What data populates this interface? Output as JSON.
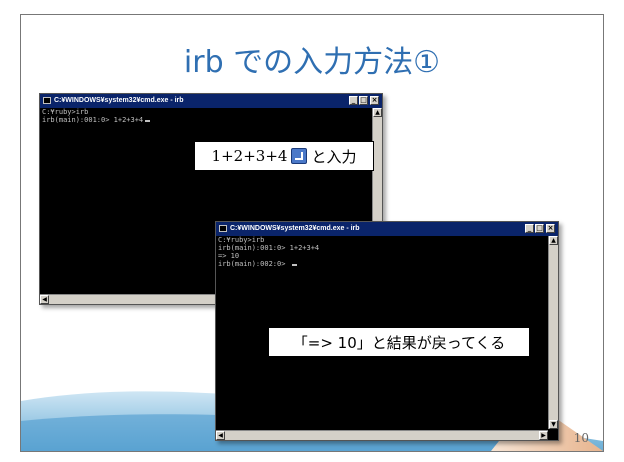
{
  "slide": {
    "title": "irb での入力方法①",
    "page_number": "10"
  },
  "window1": {
    "title": "C:¥WINDOWS¥system32¥cmd.exe - irb",
    "lines": [
      "",
      "C:¥ruby>irb",
      "irb(main):001:0> 1+2+3+4"
    ],
    "buttons": {
      "minimize": "_",
      "maximize": "□",
      "close": "×"
    }
  },
  "window2": {
    "title": "C:¥WINDOWS¥system32¥cmd.exe - irb",
    "lines": [
      "",
      "C:¥ruby>irb",
      "irb(main):001:0> 1+2+3+4",
      "=> 10",
      "irb(main):002:0> "
    ],
    "buttons": {
      "minimize": "_",
      "maximize": "□",
      "close": "×"
    }
  },
  "callout1": {
    "expr": "1+2+3+4",
    "suffix": "と入力"
  },
  "callout2": {
    "text": "「=> 10」と結果が戻ってくる"
  },
  "icons": [
    "app-icon",
    "enter-key-icon",
    "scroll-up-arrow-icon",
    "scroll-down-arrow-icon",
    "scroll-left-arrow-icon",
    "scroll-right-arrow-icon"
  ],
  "colors": {
    "title": "#2f6fb2",
    "titlebar": "#0a246a",
    "console_bg": "#000000",
    "console_text": "#c0c0c0",
    "wave": "#7fb8dc"
  }
}
